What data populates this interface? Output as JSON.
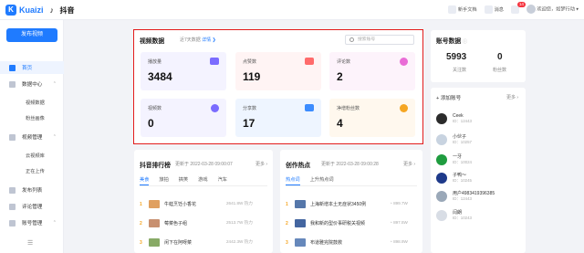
{
  "topbar": {
    "logo_text": "Kuaizi",
    "platform_label": "抖音",
    "links": [
      "新手文档",
      "消息"
    ],
    "notification_count": "14",
    "user_greeting": "欢迎您，如梦行动"
  },
  "sidebar": {
    "publish_label": "发布视频",
    "items": [
      {
        "label": "首页",
        "active": true
      },
      {
        "label": "数据中心"
      },
      {
        "label": "视频数据",
        "sub": true
      },
      {
        "label": "粉丝画像",
        "sub": true
      },
      {
        "label": "视频管理"
      },
      {
        "label": "云视频库",
        "sub": true
      },
      {
        "label": "正在上传",
        "sub": true
      },
      {
        "label": "发布列表"
      },
      {
        "label": "评论管理"
      },
      {
        "label": "账号管理"
      }
    ]
  },
  "video_data": {
    "title": "视频数据",
    "subtitle": "近7天数据",
    "subtitle_link": "详情 ❯",
    "search_placeholder": "搜索账号",
    "stats": [
      {
        "label": "播放量",
        "value": "3484",
        "icon": "video-camera-icon",
        "color": "#7b6cff"
      },
      {
        "label": "点赞数",
        "value": "119",
        "icon": "thumbs-up-icon",
        "color": "#ff6b6b"
      },
      {
        "label": "评论数",
        "value": "2",
        "icon": "comment-icon",
        "color": "#e96cd6"
      },
      {
        "label": "视频数",
        "value": "0",
        "icon": "play-icon",
        "color": "#7b6cff"
      },
      {
        "label": "分享数",
        "value": "17",
        "icon": "share-icon",
        "color": "#3b8cff"
      },
      {
        "label": "净增粉丝数",
        "value": "4",
        "icon": "user-add-icon",
        "color": "#f5a623"
      }
    ]
  },
  "account_data": {
    "title": "账号数据",
    "following_value": "5993",
    "following_label": "关注数",
    "fans_value": "0",
    "fans_label": "粉丝数"
  },
  "add_account": {
    "label": "+ 添加账号",
    "more_label": "更多 ›",
    "accounts": [
      {
        "name": "Ceek",
        "id": "ID：12443",
        "color": "#2b2b2b"
      },
      {
        "name": "小伙子",
        "id": "ID：10257",
        "color": "#c8d3e0"
      },
      {
        "name": "一牙",
        "id": "ID：10024",
        "color": "#1f9c3f"
      },
      {
        "name": "子鸭～",
        "id": "ID：10245",
        "color": "#1e3a8a"
      },
      {
        "name": "用户4983419396385",
        "id": "ID：12443",
        "color": "#9aa8b8"
      },
      {
        "name": "闫朗",
        "id": "ID：10243",
        "color": "#d8dde5"
      }
    ]
  },
  "douyin_rank": {
    "title": "抖音排行榜",
    "updated": "更新于 2022-03-28 09:00:07",
    "more": "更多 ›",
    "tabs": [
      "美食",
      "旅拍",
      "搞笑",
      "游戏",
      "汽车"
    ],
    "rows": [
      {
        "rank": "1",
        "title": "牛蛙烹饪小香花",
        "metric": "2641.8W 热力",
        "color": "#e0a060"
      },
      {
        "rank": "2",
        "title": "莓菜色子组",
        "metric": "2513.7W 热力",
        "color": "#c89070"
      },
      {
        "rank": "3",
        "title": "闲下在阿呀菜",
        "metric": "2442.3W 热力",
        "color": "#88aa66"
      }
    ]
  },
  "creation_hot": {
    "title": "创作热点",
    "updated": "更新于 2022-03-28 09:00:28",
    "more": "更多 ›",
    "tabs": [
      "热点词",
      "上升热点词"
    ],
    "rows": [
      {
        "rank": "1",
        "title": "上海新增本土无症状3450例",
        "metric": "899.7W",
        "color": "#5577aa"
      },
      {
        "rank": "2",
        "title": "我和新的型价事研税关视频",
        "metric": "897.5W",
        "color": "#4466a0"
      },
      {
        "rank": "3",
        "title": "布道雅完院鼓救",
        "metric": "898.9W",
        "color": "#6688bb"
      }
    ]
  }
}
